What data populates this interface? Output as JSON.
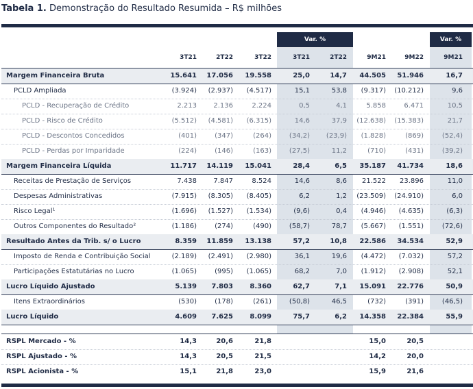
{
  "title": {
    "bold": "Tabela 1.",
    "rest": "Demonstração do Resultado Resumida – R$ milhões"
  },
  "var_label": "Var. %",
  "columns": [
    "3T21",
    "2T22",
    "3T22",
    "3T21",
    "2T22",
    "9M21",
    "9M22",
    "9M21"
  ],
  "rows": [
    {
      "label": "Margem Financeira Bruta",
      "style": "bold",
      "values": [
        "15.641",
        "17.056",
        "19.558",
        "25,0",
        "14,7",
        "44.505",
        "51.946",
        "16,7"
      ]
    },
    {
      "label": "PCLD Ampliada",
      "style": "l1",
      "values": [
        "(3.924)",
        "(2.937)",
        "(4.517)",
        "15,1",
        "53,8",
        "(9.317)",
        "(10.212)",
        "9,6"
      ]
    },
    {
      "label": "PCLD - Recuperação de Crédito",
      "style": "l2",
      "values": [
        "2.213",
        "2.136",
        "2.224",
        "0,5",
        "4,1",
        "5.858",
        "6.471",
        "10,5"
      ]
    },
    {
      "label": "PCLD - Risco de Crédito",
      "style": "l2",
      "values": [
        "(5.512)",
        "(4.581)",
        "(6.315)",
        "14,6",
        "37,9",
        "(12.638)",
        "(15.383)",
        "21,7"
      ]
    },
    {
      "label": "PCLD - Descontos Concedidos",
      "style": "l2",
      "values": [
        "(401)",
        "(347)",
        "(264)",
        "(34,2)",
        "(23,9)",
        "(1.828)",
        "(869)",
        "(52,4)"
      ]
    },
    {
      "label": "PCLD - Perdas por Imparidade",
      "style": "l2",
      "values": [
        "(224)",
        "(146)",
        "(163)",
        "(27,5)",
        "11,2",
        "(710)",
        "(431)",
        "(39,2)"
      ]
    },
    {
      "label": "Margem Financeira Líquida",
      "style": "bold",
      "values": [
        "11.717",
        "14.119",
        "15.041",
        "28,4",
        "6,5",
        "35.187",
        "41.734",
        "18,6"
      ]
    },
    {
      "label": "Receitas de Prestação de Serviços",
      "style": "l1",
      "values": [
        "7.438",
        "7.847",
        "8.524",
        "14,6",
        "8,6",
        "21.522",
        "23.896",
        "11,0"
      ]
    },
    {
      "label": "Despesas Administrativas",
      "style": "l1",
      "values": [
        "(7.915)",
        "(8.305)",
        "(8.405)",
        "6,2",
        "1,2",
        "(23.509)",
        "(24.910)",
        "6,0"
      ]
    },
    {
      "label": "Risco Legal¹",
      "style": "l1",
      "values": [
        "(1.696)",
        "(1.527)",
        "(1.534)",
        "(9,6)",
        "0,4",
        "(4.946)",
        "(4.635)",
        "(6,3)"
      ]
    },
    {
      "label": "Outros Componentes do Resultado²",
      "style": "l1",
      "values": [
        "(1.186)",
        "(274)",
        "(490)",
        "(58,7)",
        "78,7",
        "(5.667)",
        "(1.551)",
        "(72,6)"
      ]
    },
    {
      "label": "Resultado Antes da Trib. s/ o Lucro",
      "style": "bold",
      "values": [
        "8.359",
        "11.859",
        "13.138",
        "57,2",
        "10,8",
        "22.586",
        "34.534",
        "52,9"
      ]
    },
    {
      "label": "Imposto de Renda e Contribuição Social",
      "style": "l1",
      "values": [
        "(2.189)",
        "(2.491)",
        "(2.980)",
        "36,1",
        "19,6",
        "(4.472)",
        "(7.032)",
        "57,2"
      ]
    },
    {
      "label": "Participações Estatutárias no Lucro",
      "style": "l1",
      "values": [
        "(1.065)",
        "(995)",
        "(1.065)",
        "68,2",
        "7,0",
        "(1.912)",
        "(2.908)",
        "52,1"
      ]
    },
    {
      "label": "Lucro Líquido Ajustado",
      "style": "bold",
      "values": [
        "5.139",
        "7.803",
        "8.360",
        "62,7",
        "7,1",
        "15.091",
        "22.776",
        "50,9"
      ]
    },
    {
      "label": "Itens Extraordinários",
      "style": "l1",
      "values": [
        "(530)",
        "(178)",
        "(261)",
        "(50,8)",
        "46,5",
        "(732)",
        "(391)",
        "(46,5)"
      ]
    },
    {
      "label": "Lucro Líquido",
      "style": "bold",
      "values": [
        "4.609",
        "7.625",
        "8.099",
        "75,7",
        "6,2",
        "14.358",
        "22.384",
        "55,9"
      ]
    }
  ],
  "rspl_rows": [
    {
      "label": "RSPL Mercado - %",
      "values": [
        "14,3",
        "20,6",
        "21,8",
        "",
        "",
        "15,0",
        "20,5",
        ""
      ]
    },
    {
      "label": "RSPL Ajustado - %",
      "values": [
        "14,3",
        "20,5",
        "21,5",
        "",
        "",
        "14,2",
        "20,0",
        ""
      ]
    },
    {
      "label": "RSPL Acionista - %",
      "values": [
        "15,1",
        "21,8",
        "23,0",
        "",
        "",
        "15,9",
        "21,6",
        ""
      ]
    }
  ]
}
